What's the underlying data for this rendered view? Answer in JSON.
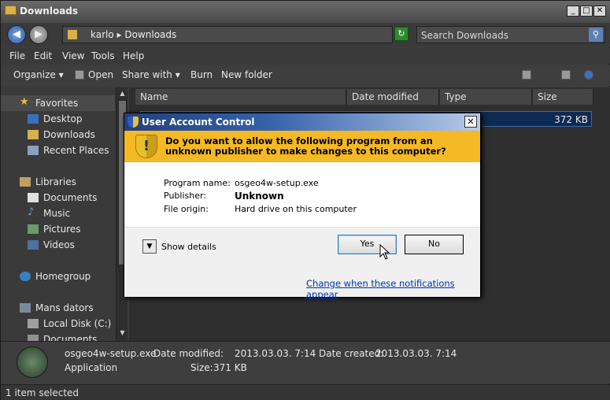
{
  "window": {
    "title": "Downloads",
    "controls": {
      "minimize": "_",
      "maximize": "□",
      "close": "✕"
    }
  },
  "address": {
    "path": "karlo ▸ Downloads",
    "search_placeholder": "Search Downloads"
  },
  "menu": [
    "File",
    "Edit",
    "View",
    "Tools",
    "Help"
  ],
  "toolbar": {
    "organize": "Organize ▾",
    "open": "Open",
    "share_with": "Share with ▾",
    "burn": "Burn",
    "new_folder": "New folder"
  },
  "sidebar": {
    "items": [
      {
        "label": "Favorites",
        "icon": "star-icon",
        "indent": 0
      },
      {
        "label": "Desktop",
        "icon": "desktop-icon",
        "indent": 1
      },
      {
        "label": "Downloads",
        "icon": "folder-icon",
        "indent": 1
      },
      {
        "label": "Recent Places",
        "icon": "recent-icon",
        "indent": 1
      },
      {
        "label": "Libraries",
        "icon": "library-icon",
        "indent": 0
      },
      {
        "label": "Documents",
        "icon": "document-icon",
        "indent": 1
      },
      {
        "label": "Music",
        "icon": "music-icon",
        "indent": 1
      },
      {
        "label": "Pictures",
        "icon": "picture-icon",
        "indent": 1
      },
      {
        "label": "Videos",
        "icon": "video-icon",
        "indent": 1
      },
      {
        "label": "Homegroup",
        "icon": "homegroup-icon",
        "indent": 0
      },
      {
        "label": "Mans dators",
        "icon": "computer-icon",
        "indent": 0
      },
      {
        "label": "Local Disk (C:)",
        "icon": "disk-icon",
        "indent": 1
      },
      {
        "label": "Documents (\\\\vbox",
        "icon": "network-drive-icon",
        "indent": 1
      }
    ]
  },
  "columns": [
    "Name",
    "Date modified",
    "Type",
    "Size"
  ],
  "file_row": {
    "size": "372 KB"
  },
  "details": {
    "filename": "osgeo4w-setup.exe",
    "modified_label": "Date modified:",
    "modified_value": "2013.03.03. 7:14",
    "created_label": "Date created:",
    "created_value": "2013.03.03. 7:14",
    "type": "Application",
    "size_label": "Size:",
    "size_value": "371 KB"
  },
  "status": "1 item selected",
  "uac": {
    "title": "User Account Control",
    "question": "Do you want to allow the following program from an unknown publisher to make changes to this computer?",
    "program_name_label": "Program name:",
    "program_name": "osgeo4w-setup.exe",
    "publisher_label": "Publisher:",
    "publisher": "Unknown",
    "origin_label": "File origin:",
    "origin": "Hard drive on this computer",
    "show_details": "Show details",
    "yes": "Yes",
    "no": "No",
    "change_link": "Change when these notifications appear"
  },
  "colors": {
    "accent": "#f5b925",
    "link": "#0033aa",
    "titlebar": "#3561aa"
  }
}
